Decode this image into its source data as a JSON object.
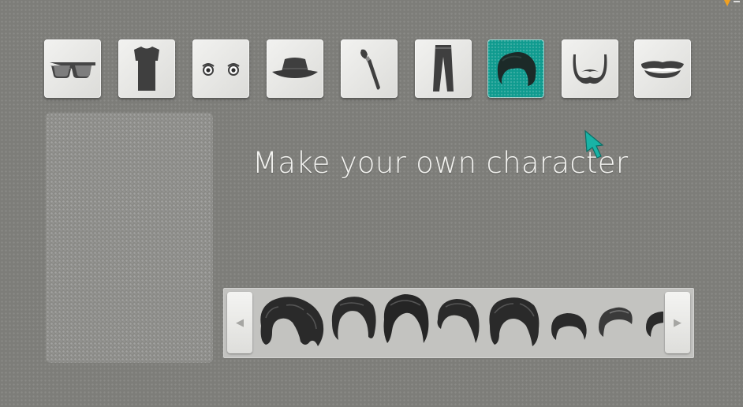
{
  "title": "Make your own character",
  "categories": [
    {
      "name": "glasses",
      "icon": "sunglasses-icon",
      "active": false
    },
    {
      "name": "shirt",
      "icon": "tshirt-icon",
      "active": false
    },
    {
      "name": "eyes",
      "icon": "eyes-icon",
      "active": false
    },
    {
      "name": "hat",
      "icon": "hat-icon",
      "active": false
    },
    {
      "name": "brush",
      "icon": "paintbrush-icon",
      "active": false
    },
    {
      "name": "pants",
      "icon": "pants-icon",
      "active": false
    },
    {
      "name": "hair",
      "icon": "hair-icon",
      "active": true
    },
    {
      "name": "beard",
      "icon": "beard-icon",
      "active": false
    },
    {
      "name": "mouth",
      "icon": "mouth-icon",
      "active": false
    }
  ],
  "hair_options": [
    "curly-long-hair-icon",
    "swept-bob-hair-icon",
    "full-bob-hair-icon",
    "side-part-bob-hair-icon",
    "wavy-bob-hair-icon",
    "short-crop-hair-icon",
    "quiff-hair-icon",
    "short-hair-partial-icon"
  ],
  "carousel": {
    "prev_icon": "chevron-left-icon",
    "next_icon": "chevron-right-icon"
  },
  "colors": {
    "background": "#7d7d79",
    "accent": "#0f9b8f",
    "tile": "#eaeae7",
    "glyph": "#3d3d3d"
  }
}
